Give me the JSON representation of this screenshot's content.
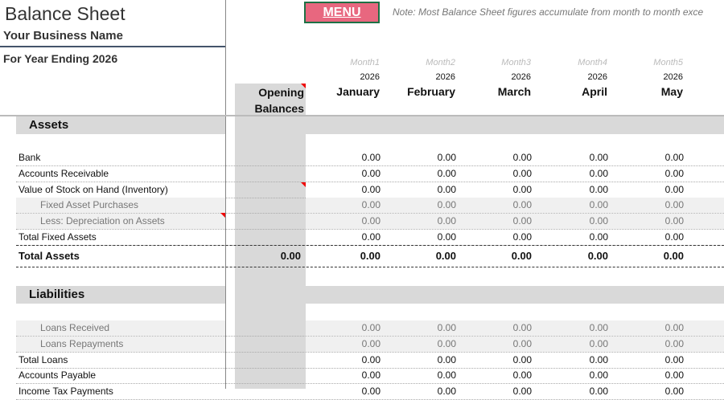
{
  "title": "Balance Sheet",
  "business": "Your Business Name",
  "year_label": "For Year Ending 2026",
  "menu_label": "MENU",
  "note": "Note: Most Balance Sheet figures accumulate from month to month exce",
  "opening_header": [
    "Opening",
    "Balances"
  ],
  "months": [
    {
      "m": "Month1",
      "y": "2026",
      "n": "January"
    },
    {
      "m": "Month2",
      "y": "2026",
      "n": "February"
    },
    {
      "m": "Month3",
      "y": "2026",
      "n": "March"
    },
    {
      "m": "Month4",
      "y": "2026",
      "n": "April"
    },
    {
      "m": "Month5",
      "y": "2026",
      "n": "May"
    }
  ],
  "sections": {
    "assets": "Assets",
    "liabilities": "Liabilities"
  },
  "rows": [
    {
      "label": "Bank",
      "type": "normal",
      "opening": "",
      "values": [
        "0.00",
        "0.00",
        "0.00",
        "0.00",
        "0.00"
      ]
    },
    {
      "label": "Accounts Receivable",
      "type": "normal",
      "opening": "",
      "values": [
        "0.00",
        "0.00",
        "0.00",
        "0.00",
        "0.00"
      ]
    },
    {
      "label": "Value of Stock on Hand (Inventory)",
      "type": "normal",
      "opening": "",
      "values": [
        "0.00",
        "0.00",
        "0.00",
        "0.00",
        "0.00"
      ]
    },
    {
      "label": "Fixed Asset Purchases",
      "type": "sub",
      "opening": "",
      "values": [
        "0.00",
        "0.00",
        "0.00",
        "0.00",
        "0.00"
      ]
    },
    {
      "label": "Less: Depreciation on Assets",
      "type": "sub",
      "opening": "",
      "values": [
        "0.00",
        "0.00",
        "0.00",
        "0.00",
        "0.00"
      ]
    },
    {
      "label": "Total Fixed Assets",
      "type": "normal",
      "opening": "",
      "values": [
        "0.00",
        "0.00",
        "0.00",
        "0.00",
        "0.00"
      ]
    },
    {
      "label": "Total Assets",
      "type": "total",
      "opening": "0.00",
      "values": [
        "0.00",
        "0.00",
        "0.00",
        "0.00",
        "0.00"
      ]
    },
    {
      "label": "Loans Received",
      "type": "sub",
      "opening": "",
      "values": [
        "0.00",
        "0.00",
        "0.00",
        "0.00",
        "0.00"
      ]
    },
    {
      "label": "Loans Repayments",
      "type": "sub",
      "opening": "",
      "values": [
        "0.00",
        "0.00",
        "0.00",
        "0.00",
        "0.00"
      ]
    },
    {
      "label": "Total Loans",
      "type": "normal",
      "opening": "",
      "values": [
        "0.00",
        "0.00",
        "0.00",
        "0.00",
        "0.00"
      ]
    },
    {
      "label": "Accounts Payable",
      "type": "normal",
      "opening": "",
      "values": [
        "0.00",
        "0.00",
        "0.00",
        "0.00",
        "0.00"
      ]
    },
    {
      "label": "Income Tax Payments",
      "type": "normal",
      "opening": "",
      "values": [
        "0.00",
        "0.00",
        "0.00",
        "0.00",
        "0.00"
      ]
    }
  ]
}
